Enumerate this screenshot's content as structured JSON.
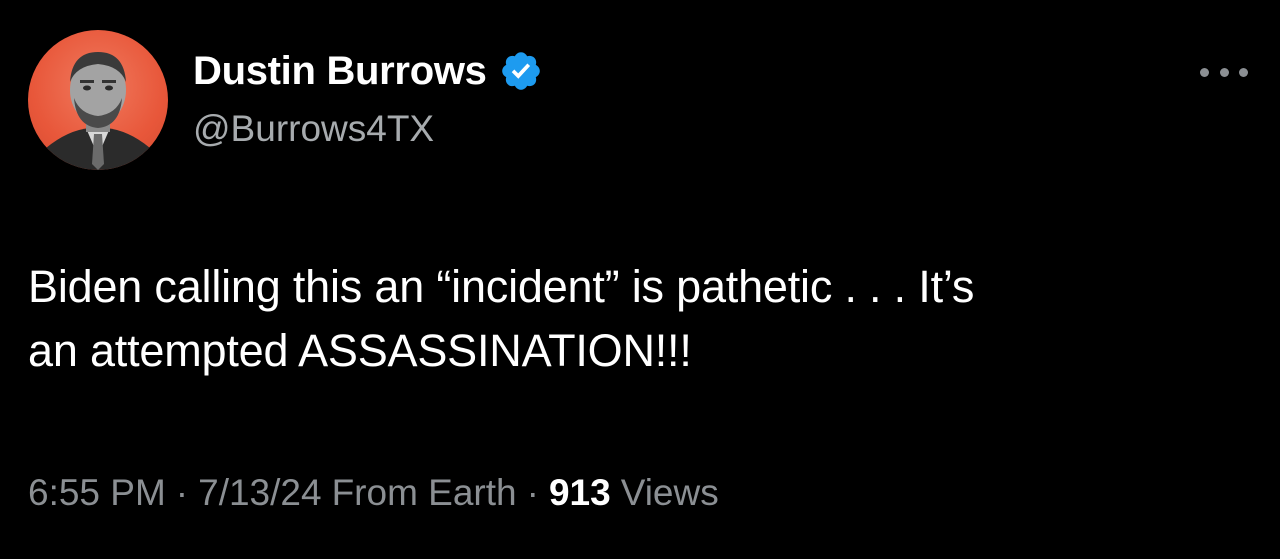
{
  "author": {
    "display_name": "Dustin Burrows",
    "handle": "@Burrows4TX",
    "verified": true,
    "avatar_background": "#e8573a",
    "verified_color": "#1d9bf0"
  },
  "tweet": {
    "text_line_1": "Biden calling this an “incident” is pathetic . . . It’s",
    "text_line_2": "an attempted ASSASSINATION!!!"
  },
  "meta": {
    "time": "6:55 PM",
    "date": "7/13/24",
    "source": "From Earth",
    "separator": "·",
    "views_count": "913",
    "views_label": "Views"
  },
  "icons": {
    "more": "more-horizontal-icon",
    "verified": "verified-badge-icon"
  }
}
